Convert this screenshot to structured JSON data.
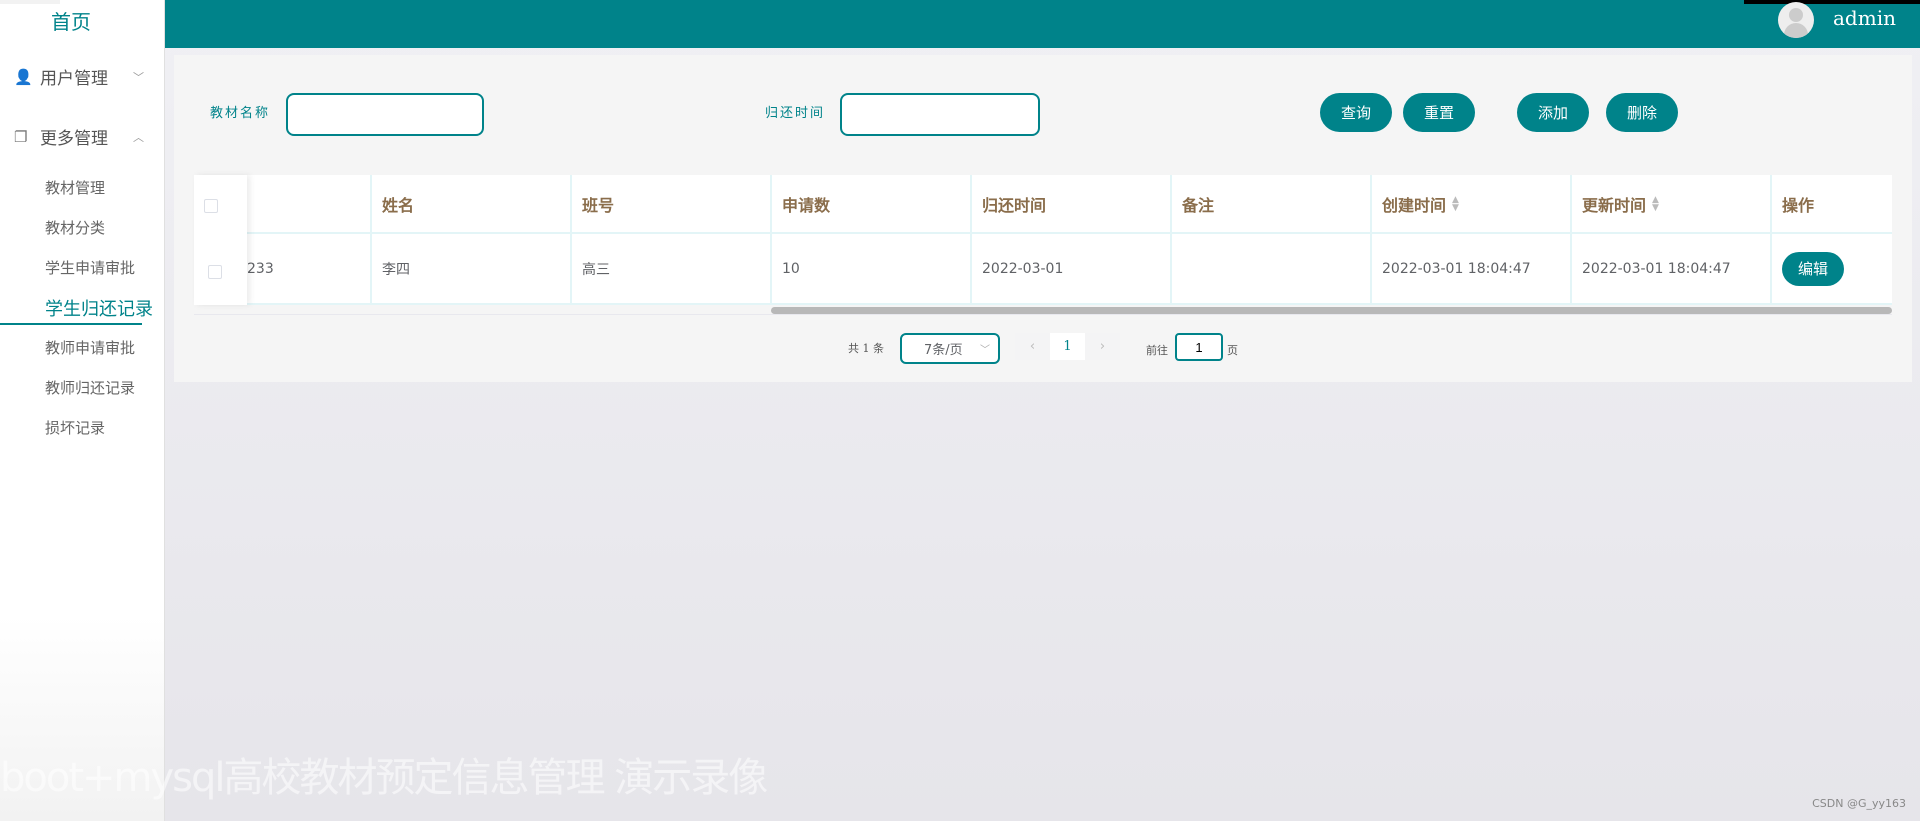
{
  "sidebar": {
    "home": "首页",
    "menus": [
      {
        "label": "用户管理",
        "icon": "user-icon",
        "expanded": false
      },
      {
        "label": "更多管理",
        "icon": "copy-icon",
        "expanded": true
      }
    ],
    "items": [
      "教材管理",
      "教材分类",
      "学生申请审批",
      "学生归还记录",
      "教师申请审批",
      "教师归还记录",
      "损坏记录"
    ],
    "active": "学生归还记录"
  },
  "header": {
    "username": "admin"
  },
  "search": {
    "name_label": "教材名称",
    "name_value": "",
    "return_label": "归还时间",
    "return_value": ""
  },
  "buttons": {
    "query": "查询",
    "reset": "重置",
    "add": "添加",
    "delete": "删除"
  },
  "table": {
    "columns": [
      "",
      "姓名",
      "班号",
      "申请数",
      "归还时间",
      "备注",
      "创建时间",
      "更新时间",
      "操作"
    ],
    "rows": [
      {
        "c0": "233",
        "name": "李四",
        "class": "高三",
        "count": "10",
        "return": "2022-03-01",
        "note": "",
        "created": "2022-03-01 18:04:47",
        "updated": "2022-03-01 18:04:47",
        "action": "编辑"
      }
    ]
  },
  "pagination": {
    "total": "共 1 条",
    "page_size": "7条/页",
    "current": "1",
    "goto_label": "前往",
    "goto_value": "1",
    "page_unit": "页"
  },
  "overlay": {
    "watermark": "boot+mysql高校教材预定信息管理 演示录像",
    "credit": "CSDN @G_yy163"
  },
  "colors": {
    "primary": "#00838a",
    "header_text": "#8a6d4b"
  }
}
